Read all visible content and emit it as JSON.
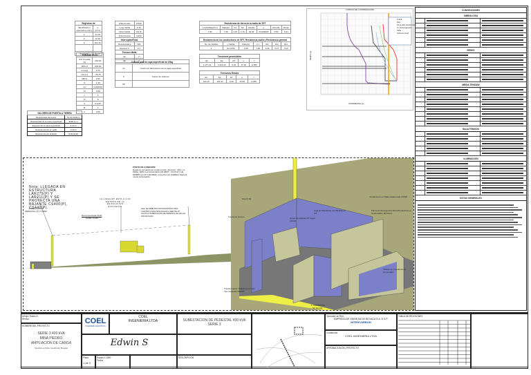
{
  "registros": {
    "title": "Registros de",
    "headers": [
      "Identificacion electrodos (ohm)",
      "ρ (Ω*m)"
    ],
    "rows": [
      [
        "1",
        "31.00"
      ],
      [
        "2",
        "12.30"
      ],
      [
        "3",
        "101.00"
      ]
    ],
    "footer": [
      "Promedio",
      "51.22"
    ]
  },
  "parametros": {
    "title": "PARAMETROS",
    "rows": [
      [
        "ICC Hmedia (A)",
        "200.00"
      ],
      [
        "MPH Z",
        "200.00"
      ],
      [
        "tc (seg)",
        "0.75"
      ],
      [
        "LM (m)",
        "75.75"
      ],
      [
        "hB(m)",
        "0.00"
      ],
      [
        "N",
        "1.30"
      ],
      [
        "nm",
        "0.000150"
      ],
      [
        "Ki",
        "0.65"
      ],
      [
        "n",
        "5"
      ],
      [
        "Ki",
        "5"
      ],
      [
        "d",
        "0.0127"
      ],
      [
        "B",
        "1"
      ],
      [
        "h",
        "0.50"
      ]
    ]
  },
  "electrodos": {
    "rows": [
      [
        "# Electrodos",
        "0.000"
      ],
      [
        "Long Varilla",
        "2.40"
      ],
      [
        "Diam Varilla",
        "0.016"
      ],
      [
        "# Perímetros",
        "4.000"
      ]
    ],
    "sub1": "Interruptor/Fusil",
    "rows2": [
      [
        "Resistividad ρ",
        "100"
      ],
      [
        "Espesor h",
        "0.1"
      ]
    ],
    "sub2": "Tension Malla",
    "rows3": [
      [
        "Ec",
        "?"
      ],
      [
        "Ep",
        "?"
      ]
    ]
  },
  "calculo": {
    "title": "Calculo para la capa superficial de 20kg",
    "rows": [
      [
        "Cs",
        "Factor de disminucion de la capa superficial"
      ],
      [
        "K",
        "Factor de reflexion"
      ],
      [
        "KP",
        ""
      ]
    ]
  },
  "resistencia_malla": {
    "title": "Resistencia de tierra de la malla de SPT",
    "headers": [
      "Lm(O)/Rate(Km)",
      "Rate(m)",
      "K1",
      "K2",
      "Atm(Ω)",
      "ρ",
      "Rmedio",
      "Rmax"
    ],
    "values": [
      "7.30",
      "7.00",
      "1.15",
      "4.70",
      "46.30",
      "64.000000",
      "0.50",
      "0.21"
    ]
  },
  "resistencia_varillas": {
    "title": "Resistencia de los conductores de SPT, Resistencia malla y Resistencia general",
    "headers": [
      "No. de Varillas",
      "ρ Varilla",
      "Rate(m)",
      "r.l.t.",
      "Rm",
      "Rm",
      "Rcc"
    ],
    "values": [
      "4",
      "0.0·0070",
      "2.00",
      "1.00",
      "0.30",
      "0.27",
      "0.20"
    ]
  },
  "tensiones_permisibles": {
    "title": "Tensiones permisibles",
    "headers": [
      "Ec",
      "Ep",
      "ΔT",
      "e",
      "f"
    ],
    "values": [
      "1 477.21",
      "3 242.22",
      "0.20",
      "37.20",
      "0.180"
    ]
  },
  "tensiones_reales": {
    "title": "Tensiones Reales",
    "headers": [
      "Ec",
      "Ep",
      "ΔT",
      "p",
      "f"
    ],
    "values": [
      "102.16",
      "131.40",
      "0.00",
      "16.50",
      "0.180"
    ]
  },
  "valores": {
    "title": "VALORES DE PUESTA A TIERRA",
    "rows": [
      [
        "Resistividad del suelo",
        "51.22 OHM-m"
      ],
      [
        "Resistividad de la capa superficial",
        "3000 Ω·m"
      ],
      [
        "Espesor de la capa superficial",
        "0.10 m"
      ],
      [
        "Resistencia de la malla",
        "0.20 Ω"
      ],
      [
        "Resistencia de la Malla",
        "0.20 OHM"
      ]
    ]
  },
  "chart": {
    "title": "CURVAS DE COORDINACION",
    "xlabel": "CORRIENTE (A)",
    "ylabel": "TIEMPO (s)",
    "legend": [
      "Fusible",
      "Relé",
      "Curva daño transformador",
      "Int. Termomagnético",
      "Cable",
      "Corriente Inrush"
    ]
  },
  "elevation": {
    "note_left": "Nota: LLEGADA EN ESTRUCTURA LAR275(P) Y LAR211(P) Y SE PROYECTA UNA BAJANTE CS400(P), CS440(P).",
    "substation": "SUBESTACION PEDESTAL (P) CT0500",
    "punto_title": "PUNTO DE CONEXIÓN:",
    "punto_text": "Desde la red aérea de media tensión dirección: VDA. LA PEÑA, MPIO LA GUACHETA (05.0859° -73.6716°) CD. 819808 con PF ILEGIBLE, proyectar red (AEREA) hasta la nueva subestación.",
    "linea": "LA LINEA MT ESTA A 4.00 METROS DE LA EDIFICACION EXISTENTE",
    "red": "Red proyectada 3x4/0",
    "red2": "ACSR 13.2kV",
    "note_right": "Nota: SE DEBE PROYECTAR ESTRUCTURA LAR275(P) PARA PROLONGAR LA RED DE MT HASTA LA SUBESTACION DE PEDESTAL DE 400 kVA PROYECTADA"
  },
  "view3d": {
    "nivel": "Nivel 0.00",
    "cerramiento": "Cerramiento en Malla eslabonada CS520",
    "celda": "Caja de Maniobras con Medida en MT",
    "grupo": "Grupo de Medida MT según CS916",
    "planta": "Planta de Emergencia 400 kVA efectivos en GUACHETA, BOYACA",
    "puerta": "Puerta de Acceso",
    "transformador": "Transformador Trifásico en Aceite Tipo Pedestal 400kVA",
    "tablero": "Tablero de Transferencia proyectado",
    "caption": "1. ISOMETRIA",
    "scale": "Sin Escala"
  },
  "legend_panel": {
    "title": "CONVENCIONES",
    "sections": [
      "SIMBOLOGIA",
      "REDES",
      "MEDIA TENSION",
      "BAJA TENSION",
      "ILUMINACION",
      "NOTAS GENERALES"
    ]
  },
  "title_block": {
    "dibujo": "Dibujó:",
    "reviso": "Revisó:",
    "dibujo_name": "Edwin G.",
    "project_label": "NOMBRE DEL PROYECTO",
    "project": [
      "SERIE 3 400 kVA",
      "MINA PIEDRO",
      "AMPLIACION DE CARGA"
    ],
    "project_sub": "Vereda La Peña, Guacheta, Boyacá",
    "company": "COEL",
    "company_full": "INGENIERIA LTDA",
    "company_sub": "INGENIERIA ELECTRICA",
    "drawing_title": "SUBESTACION DE PEDESTAL 400 kVA",
    "drawing_sub": "SERIE 3",
    "signature": "Edwin S",
    "sheet_label": "Plano",
    "sheet": "1 de 2",
    "scale_label": "Escala",
    "scale": "1:1000",
    "date_label": "Fecha",
    "operador": "Operador de Red",
    "operador_name": "EMPRESA DE ENERGIA DE BOYACA S.A. E.S.P.",
    "constructor": "Constructor",
    "constructor_name": "COEL INGENIERIA LTDA",
    "aprobado": "APROBACION DEL PROYECTO",
    "interc": "INTERCARBON",
    "revisiones": "TABLA DE REVISIONES",
    "descripcion": "DESCRIPCION"
  }
}
